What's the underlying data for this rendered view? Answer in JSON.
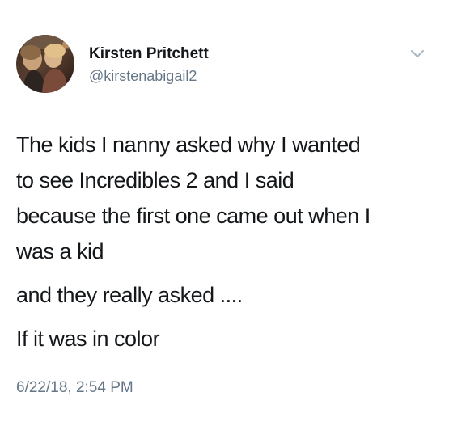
{
  "tweet": {
    "display_name": "Kirsten Pritchett",
    "handle": "@kirstenabigail2",
    "paragraphs": [
      [
        "The kids I nanny asked why I wanted",
        "to see Incredibles 2 and I said",
        "because the first one came out when I",
        "was a kid"
      ],
      [
        "and they really asked ...."
      ],
      [
        "If it was in color"
      ]
    ],
    "timestamp": "6/22/18, 2:54 PM"
  },
  "icons": {
    "avatar": "profile-photo",
    "menu": "chevron-down-icon"
  },
  "colors": {
    "primary_text": "#14171a",
    "secondary_text": "#657786",
    "chevron": "#aab8c2",
    "background": "#ffffff"
  }
}
